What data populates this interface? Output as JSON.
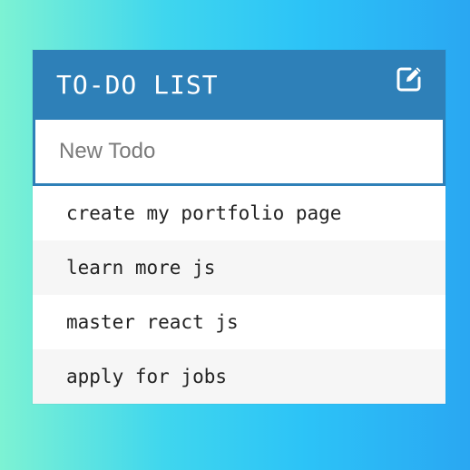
{
  "header": {
    "title": "TO-DO LIST",
    "edit_icon": "pencil-square-icon"
  },
  "new_todo": {
    "placeholder": "New Todo",
    "value": ""
  },
  "todos": [
    {
      "label": "create my portfolio page"
    },
    {
      "label": "learn more js"
    },
    {
      "label": "master react js"
    },
    {
      "label": "apply for jobs"
    }
  ],
  "colors": {
    "header_bg": "#2e80b8",
    "row_alt_bg": "#f6f6f6",
    "text": "#222222"
  }
}
